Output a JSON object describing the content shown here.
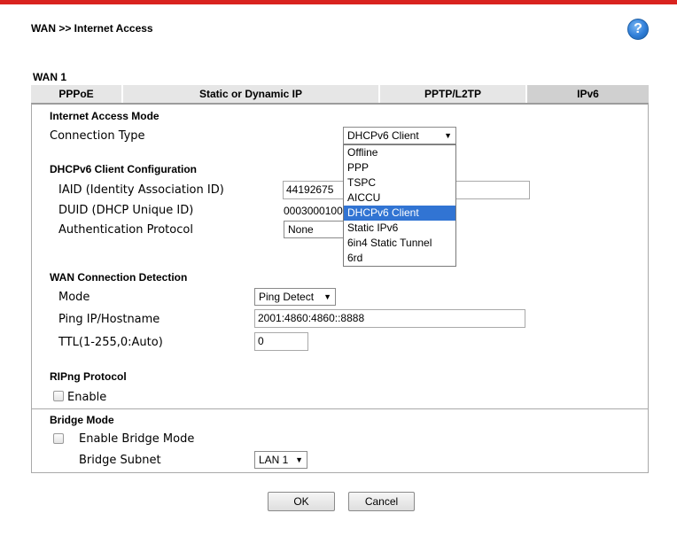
{
  "header": {
    "title": "WAN >> Internet Access",
    "help_icon": "help-icon"
  },
  "wan_label": "WAN 1",
  "tabs": [
    "PPPoE",
    "Static or Dynamic IP",
    "PPTP/L2TP",
    "IPv6"
  ],
  "internet_access": {
    "heading": "Internet Access Mode",
    "connection_type_label": "Connection Type",
    "connection_type_value": "DHCPv6 Client",
    "options": [
      "Offline",
      "PPP",
      "TSPC",
      "AICCU",
      "DHCPv6 Client",
      "Static IPv6",
      "6in4 Static Tunnel",
      "6rd"
    ]
  },
  "dhcp": {
    "heading": "DHCPv6 Client Configuration",
    "iaid_label": "IAID (Identity Association ID)",
    "iaid_value": "44192675",
    "duid_label": "DUID (DHCP Unique ID)",
    "duid_value": "0003000100",
    "auth_label": "Authentication Protocol",
    "auth_value": "None"
  },
  "detection": {
    "heading": "WAN Connection Detection",
    "mode_label": "Mode",
    "mode_value": "Ping Detect",
    "ping_label": "Ping IP/Hostname",
    "ping_value": "2001:4860:4860::8888",
    "ttl_label": "TTL(1-255,0:Auto)",
    "ttl_value": "0"
  },
  "ripng": {
    "heading": "RIPng Protocol",
    "enable_label": "Enable"
  },
  "bridge": {
    "heading": "Bridge Mode",
    "enable_label": "Enable Bridge Mode",
    "subnet_label": "Bridge Subnet",
    "subnet_value": "LAN 1"
  },
  "buttons": {
    "ok": "OK",
    "cancel": "Cancel"
  }
}
